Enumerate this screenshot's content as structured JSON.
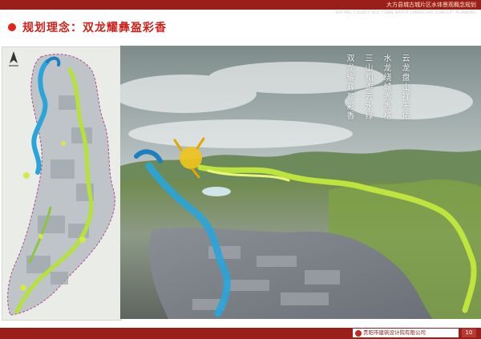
{
  "header": {
    "title": "大方县城古城片区水体景观概念规划",
    "subtitle": "DAFANG COUNTY OLD TOWN WATER LANDSCAPE CONCEPT PLANNING"
  },
  "section": {
    "heading": "规划理念：双龙耀彝盈彩香"
  },
  "poem": {
    "lines": [
      "云龙盘山祥天佑",
      "水龙绕城秀香格",
      "三山相距云水绿",
      "双龙耀彝盈彩香"
    ]
  },
  "footer": {
    "company": "贵阳市建筑设计院有限公司",
    "page_number": "10"
  },
  "colors": {
    "accent_red": "#d0211a",
    "band_red": "#9a1f1a",
    "river_blue": "#2aa4d9",
    "dragon_green": "#b6e13a"
  },
  "icons": {
    "bullet": "red-dot-icon",
    "north_arrow": "north-arrow-icon",
    "logo": "company-logo-icon"
  }
}
